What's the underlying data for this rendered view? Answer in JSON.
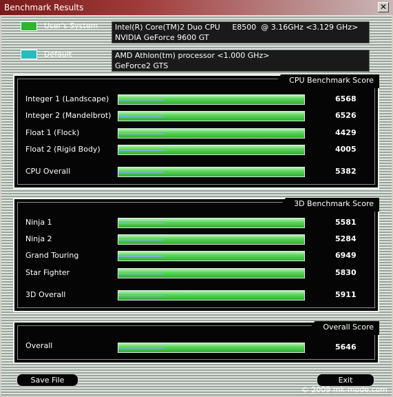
{
  "window": {
    "title": "Benchmark Results",
    "close_glyph": "✕"
  },
  "systems": [
    {
      "label": "User's System",
      "color": "#2fb52f",
      "line1": "Intel(R) Core(TM)2 Duo CPU     E8500  @ 3.16GHz <3.129 GHz>",
      "line2": "NVIDIA GeForce 9600 GT"
    },
    {
      "label": "Default",
      "color": "#28bcbc",
      "line1": "AMD Athlon(tm) processor <1.000 GHz>",
      "line2": "GeForce2 GTS"
    }
  ],
  "cpu": {
    "title": "CPU Benchmark Score",
    "rows": [
      {
        "label": "Integer 1 (Landscape)",
        "score": "6568",
        "level": 1.0
      },
      {
        "label": "Integer 2 (Mandelbrot)",
        "score": "6526",
        "level": 1.0
      },
      {
        "label": "Float 1 (Flock)",
        "score": "4429",
        "level": 1.0
      },
      {
        "label": "Float 2 (Rigid Body)",
        "score": "4005",
        "level": 1.0
      },
      {
        "label": "CPU Overall",
        "score": "5382",
        "level": 1.0
      }
    ]
  },
  "threed": {
    "title": "3D Benchmark Score",
    "rows": [
      {
        "label": "Ninja 1",
        "score": "5581",
        "level": 1.0
      },
      {
        "label": "Ninja 2",
        "score": "5284",
        "level": 1.0
      },
      {
        "label": "Grand Touring",
        "score": "6949",
        "level": 1.0
      },
      {
        "label": "Star Fighter",
        "score": "5830",
        "level": 1.0
      },
      {
        "label": "3D Overall",
        "score": "5911",
        "level": 1.0
      }
    ]
  },
  "overall": {
    "title": "Overall Score",
    "rows": [
      {
        "label": "Overall",
        "score": "5646",
        "level": 1.0
      }
    ]
  },
  "footer": {
    "save_label": "Save File",
    "exit_label": "Exit",
    "copyright": "© 2009 mk-mode.com"
  }
}
